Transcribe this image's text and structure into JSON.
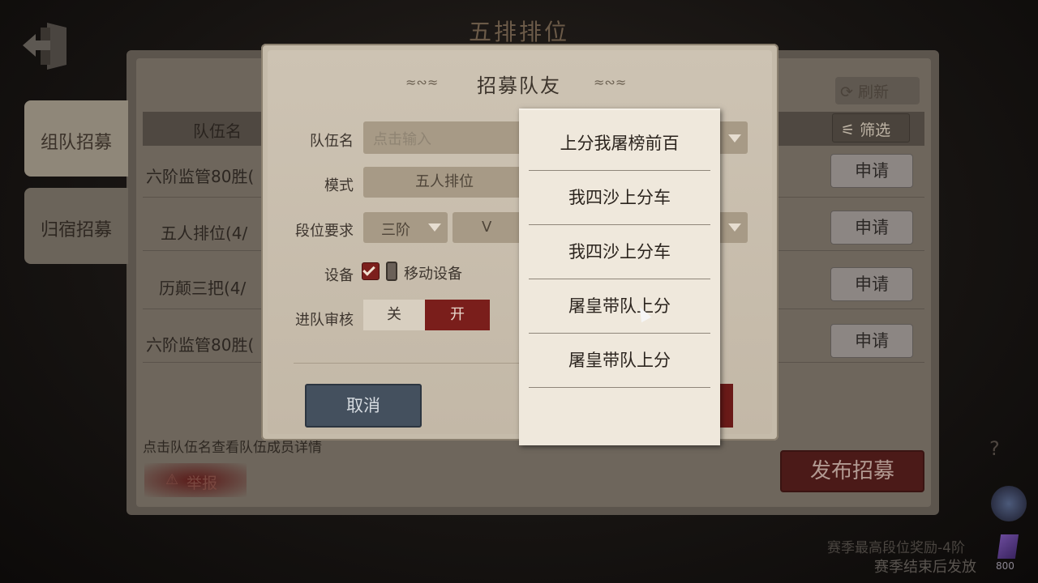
{
  "background": {
    "screen_title": "五排排位",
    "tabs": [
      {
        "label": "组队招募",
        "active": true
      },
      {
        "label": "归宿招募",
        "active": false
      }
    ],
    "refresh_label": "刷新",
    "filter_label": "筛选",
    "column_team_name": "队伍名",
    "rows": [
      {
        "name": "六阶监管80胜(",
        "apply": "申请"
      },
      {
        "name": "五人排位(4/",
        "apply": "申请"
      },
      {
        "name": "历颠三把(4/",
        "apply": "申请"
      },
      {
        "name": "六阶监管80胜(",
        "apply": "申请"
      }
    ],
    "hint": "点击队伍名查看队伍成员详情",
    "report_label": "举报",
    "publish_label": "发布招募",
    "help_label": "?",
    "season_reward": "赛季最高段位奖励-4阶",
    "season_note": "赛季结束后发放",
    "gem_count": "800"
  },
  "dialog": {
    "title": "招募队友",
    "team_name_label": "队伍名",
    "team_name_placeholder": "点击输入",
    "mode_label": "模式",
    "mode_value": "五人排位",
    "rank_label": "段位要求",
    "rank_tier": "三阶",
    "rank_sub": "V",
    "device_label": "设备",
    "device_option": "移动设备",
    "device_checked": true,
    "review_label": "进队审核",
    "review_off": "关",
    "review_on": "开",
    "review_state": "on",
    "cancel_label": "取消"
  },
  "dropdown": {
    "items": [
      "上分我屠榜前百",
      "我四沙上分车",
      "我四沙上分车",
      "屠皇带队上分",
      "屠皇带队上分"
    ],
    "hovered_index": 3
  },
  "colors": {
    "accent_red": "#7a1e1b",
    "cancel_blue": "#44505e",
    "parchment": "#c5bbaa"
  }
}
